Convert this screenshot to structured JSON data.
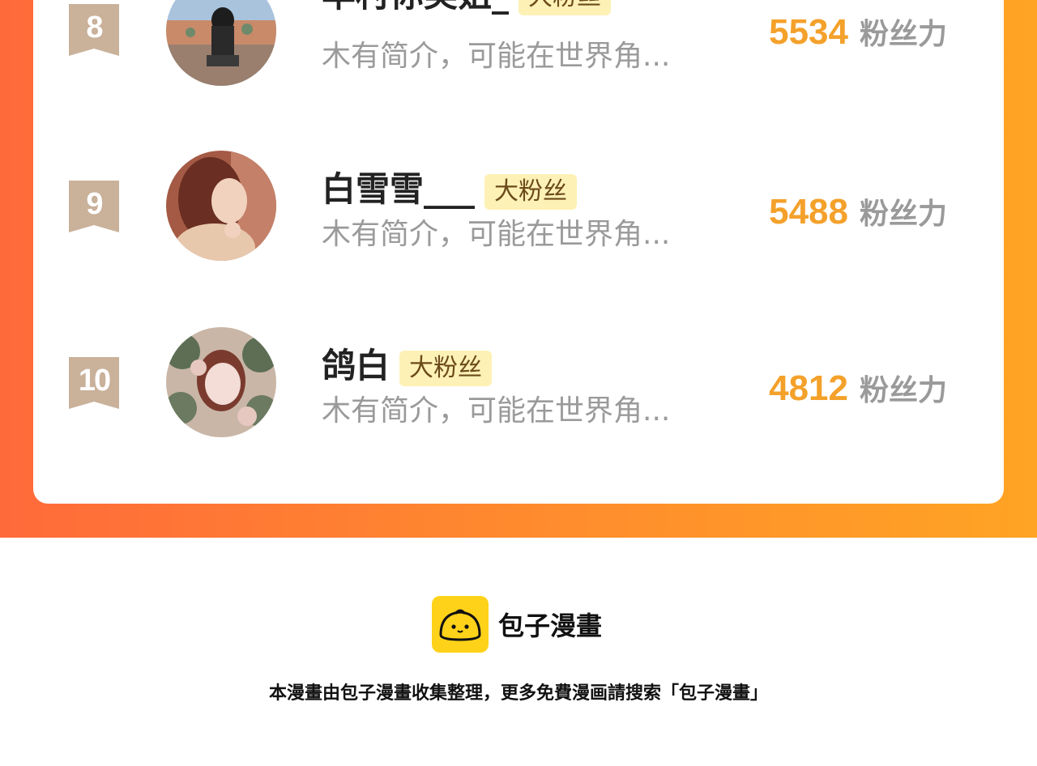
{
  "leaderboard": {
    "entries": [
      {
        "rank": "8",
        "name": "羊村你美姐_",
        "tag": "大粉丝",
        "bio": "木有简介，可能在世界角...",
        "score": "5534",
        "score_label": "粉丝力"
      },
      {
        "rank": "9",
        "name": "白雪雪___",
        "tag": "大粉丝",
        "bio": "木有简介，可能在世界角...",
        "score": "5488",
        "score_label": "粉丝力"
      },
      {
        "rank": "10",
        "name": "鸽白",
        "tag": "大粉丝",
        "bio": "木有简介，可能在世界角...",
        "score": "4812",
        "score_label": "粉丝力"
      }
    ]
  },
  "footer": {
    "brand": "包子漫畫",
    "note": "本漫畫由包子漫畫收集整理，更多免費漫画請搜索「包子漫畫」"
  },
  "colors": {
    "gradient_start": "#ff6a3a",
    "gradient_end": "#ffa424",
    "score": "#f4a12b",
    "badge": "#c9b19a",
    "tag_bg": "#fdf1b6",
    "logo": "#ffd21a"
  }
}
